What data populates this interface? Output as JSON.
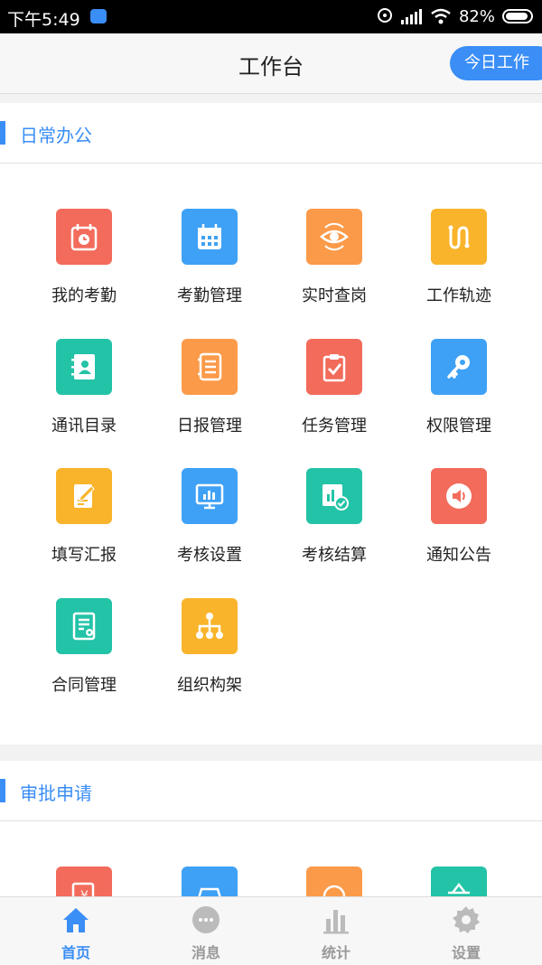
{
  "status_bar": {
    "time": "下午5:49",
    "battery": "82%"
  },
  "header": {
    "title": "工作台",
    "today_button": "今日工作"
  },
  "sections": [
    {
      "title": "日常办公",
      "items": [
        {
          "label": "我的考勤",
          "icon": "attendance-icon",
          "color": "#f26b5b"
        },
        {
          "label": "考勤管理",
          "icon": "calendar-icon",
          "color": "#3ea1f5"
        },
        {
          "label": "实时查岗",
          "icon": "eye-icon",
          "color": "#fb9a49"
        },
        {
          "label": "工作轨迹",
          "icon": "track-icon",
          "color": "#f9b42b"
        },
        {
          "label": "通讯目录",
          "icon": "contacts-icon",
          "color": "#23c3a7"
        },
        {
          "label": "日报管理",
          "icon": "notebook-icon",
          "color": "#fb9a49"
        },
        {
          "label": "任务管理",
          "icon": "clipboard-check-icon",
          "color": "#f26b5b"
        },
        {
          "label": "权限管理",
          "icon": "key-icon",
          "color": "#3ea1f5"
        },
        {
          "label": "填写汇报",
          "icon": "edit-report-icon",
          "color": "#f9b42b"
        },
        {
          "label": "考核设置",
          "icon": "monitor-chart-icon",
          "color": "#3ea1f5"
        },
        {
          "label": "考核结算",
          "icon": "chart-check-icon",
          "color": "#23c3a7"
        },
        {
          "label": "通知公告",
          "icon": "speaker-icon",
          "color": "#f26b5b"
        },
        {
          "label": "合同管理",
          "icon": "contract-icon",
          "color": "#23c3a7"
        },
        {
          "label": "组织构架",
          "icon": "org-chart-icon",
          "color": "#f9b42b"
        }
      ]
    },
    {
      "title": "审批申请",
      "items": [
        {
          "label": "",
          "icon": "invoice-icon",
          "color": "#f26b5b"
        },
        {
          "label": "",
          "icon": "car-icon",
          "color": "#3ea1f5"
        },
        {
          "label": "",
          "icon": "clock-icon",
          "color": "#fb9a49"
        },
        {
          "label": "",
          "icon": "basket-icon",
          "color": "#23c3a7"
        }
      ]
    }
  ],
  "tabs": [
    {
      "label": "首页",
      "icon": "home-icon",
      "active": true
    },
    {
      "label": "消息",
      "icon": "message-icon",
      "active": false
    },
    {
      "label": "统计",
      "icon": "stats-icon",
      "active": false
    },
    {
      "label": "设置",
      "icon": "settings-icon",
      "active": false
    }
  ],
  "colors": {
    "accent": "#3a8ef6",
    "inactive": "#bbbbbb"
  }
}
